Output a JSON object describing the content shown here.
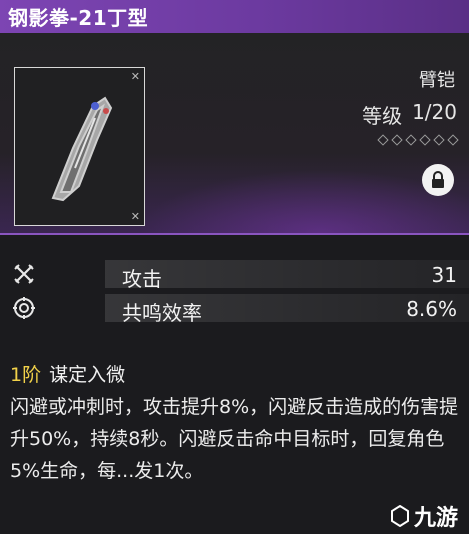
{
  "item": {
    "title": "钢影拳-21丁型",
    "type": "臂铠",
    "level_label": "等级",
    "level_value": "1/20",
    "star_count": 6,
    "locked": true
  },
  "stats": [
    {
      "label": "攻击",
      "value": "31",
      "icon": "attack-icon"
    },
    {
      "label": "共鸣效率",
      "value": "8.6%",
      "icon": "resonance-icon"
    }
  ],
  "skill": {
    "rank": "1阶",
    "name": "谋定入微",
    "description": "闪避或冲刺时，攻击提升8%，闪避反击造成的伤害提升50%，持续8秒。闪避反击命中目标时，回复角色5%生命，每...发1次。"
  },
  "watermark": {
    "site": "九游"
  },
  "colors": {
    "title_bar": "#7d45b3",
    "rank_highlight": "#f2d24a",
    "accent_border": "#8a55c0"
  }
}
